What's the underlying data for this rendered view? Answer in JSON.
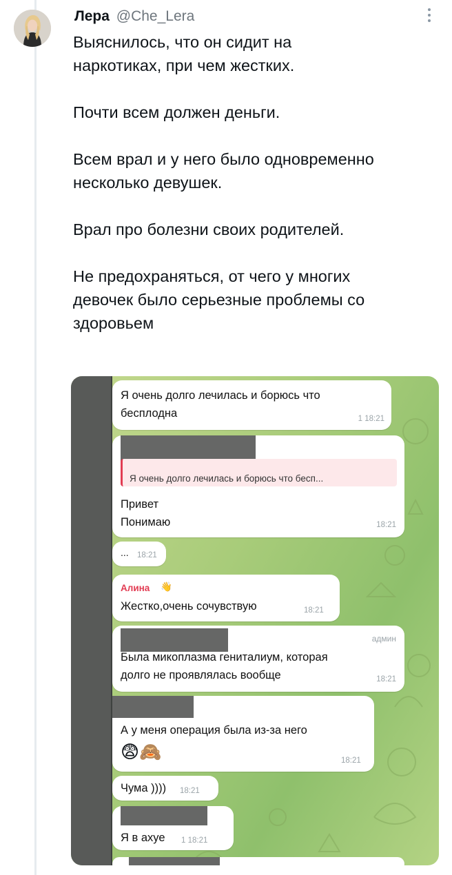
{
  "tweet": {
    "author_name": "Лера",
    "author_handle": "@Che_Lera",
    "text": "Выяснилось, что он сидит на\nнаркотиках, при чем жестких.\n\nПочти всем должен деньги.\n\nВсем врал и у него было одновременно\nнесколько девушек.\n\nВрал про болезни своих родителей.\n\nНе предохраняться, от чего у многих\nдевочек было серьезные проблемы со\nздоровьем"
  },
  "colors": {
    "quote_accent": "#e23b52",
    "chat_background": "#a9cc7a"
  },
  "chat": {
    "messages": [
      {
        "line1": "Я очень долго лечилась и борюсь что",
        "line2": "бесплодна",
        "meta": "1  18:21"
      },
      {
        "quote": "Я очень долго лечилась и борюсь что бесп...",
        "line1": "Привет",
        "line2": "Понимаю",
        "time": "18:21"
      },
      {
        "text": "...",
        "time": "18:21"
      },
      {
        "sender": "Алина",
        "sender_emoji": "👋",
        "text": "Жестко,очень сочувствую",
        "time": "18:21"
      },
      {
        "admin": "админ",
        "line1": "Была микоплазма гениталиум, которая",
        "line2": "долго не проявлялась вообще",
        "time": "18:21"
      },
      {
        "text": "А у меня операция была из-за него",
        "emoji": "😨🙈",
        "time": "18:21"
      },
      {
        "text": "Чума ))))",
        "time": "18:21"
      },
      {
        "text": "Я в ахуе",
        "meta": "1  18:21"
      }
    ]
  }
}
